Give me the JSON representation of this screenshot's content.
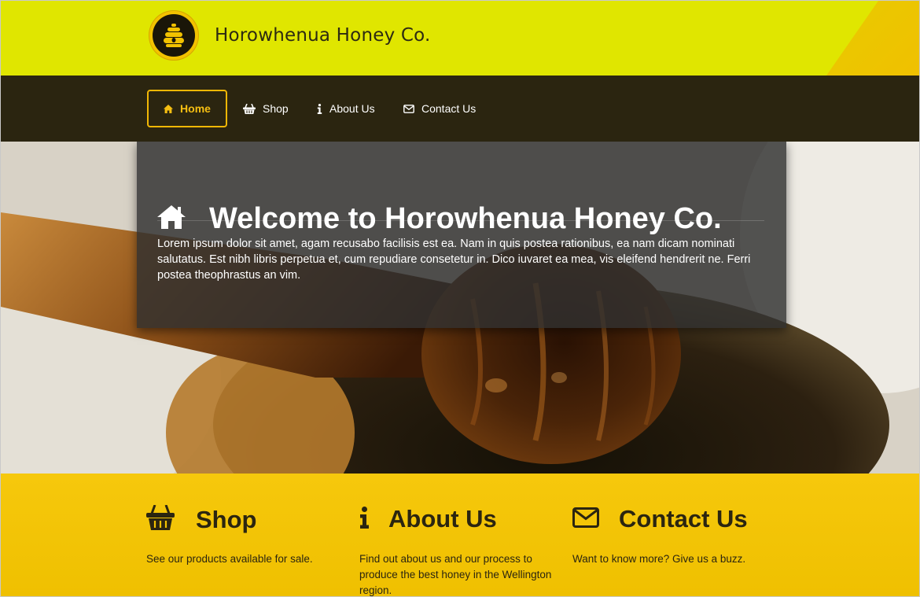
{
  "header": {
    "brand_name": "Horowhenua Honey Co.",
    "logo_icon": "beehive-icon",
    "background_color": "#e0e600"
  },
  "nav": {
    "background_color": "#2b2510",
    "accent_color": "#f2b705",
    "items": [
      {
        "label": "Home",
        "icon": "home-icon",
        "active": true
      },
      {
        "label": "Shop",
        "icon": "basket-icon",
        "active": false
      },
      {
        "label": "About Us",
        "icon": "info-icon",
        "active": false
      },
      {
        "label": "Contact Us",
        "icon": "envelope-icon",
        "active": false
      }
    ]
  },
  "hero": {
    "title": "Welcome to Horowhenua Honey Co.",
    "title_icon": "home-icon",
    "body": "Lorem ipsum dolor sit amet, agam recusabo facilisis est ea. Nam in quis postea rationibus, ea nam dicam nominati salutatus. Est nibh libris perpetua et, cum repudiare consetetur in. Dico iuvaret ea mea, vis eleifend hendrerit ne. Ferri postea theophrastus an vim."
  },
  "features": {
    "background_color": "#f2c200",
    "items": [
      {
        "title": "Shop",
        "icon": "basket-icon",
        "text": "See our products available for sale."
      },
      {
        "title": "About Us",
        "icon": "info-icon",
        "text": "Find out about us and our process to produce the best honey in the Wellington region."
      },
      {
        "title": "Contact Us",
        "icon": "envelope-icon",
        "text": "Want to know more? Give us a buzz."
      }
    ]
  }
}
